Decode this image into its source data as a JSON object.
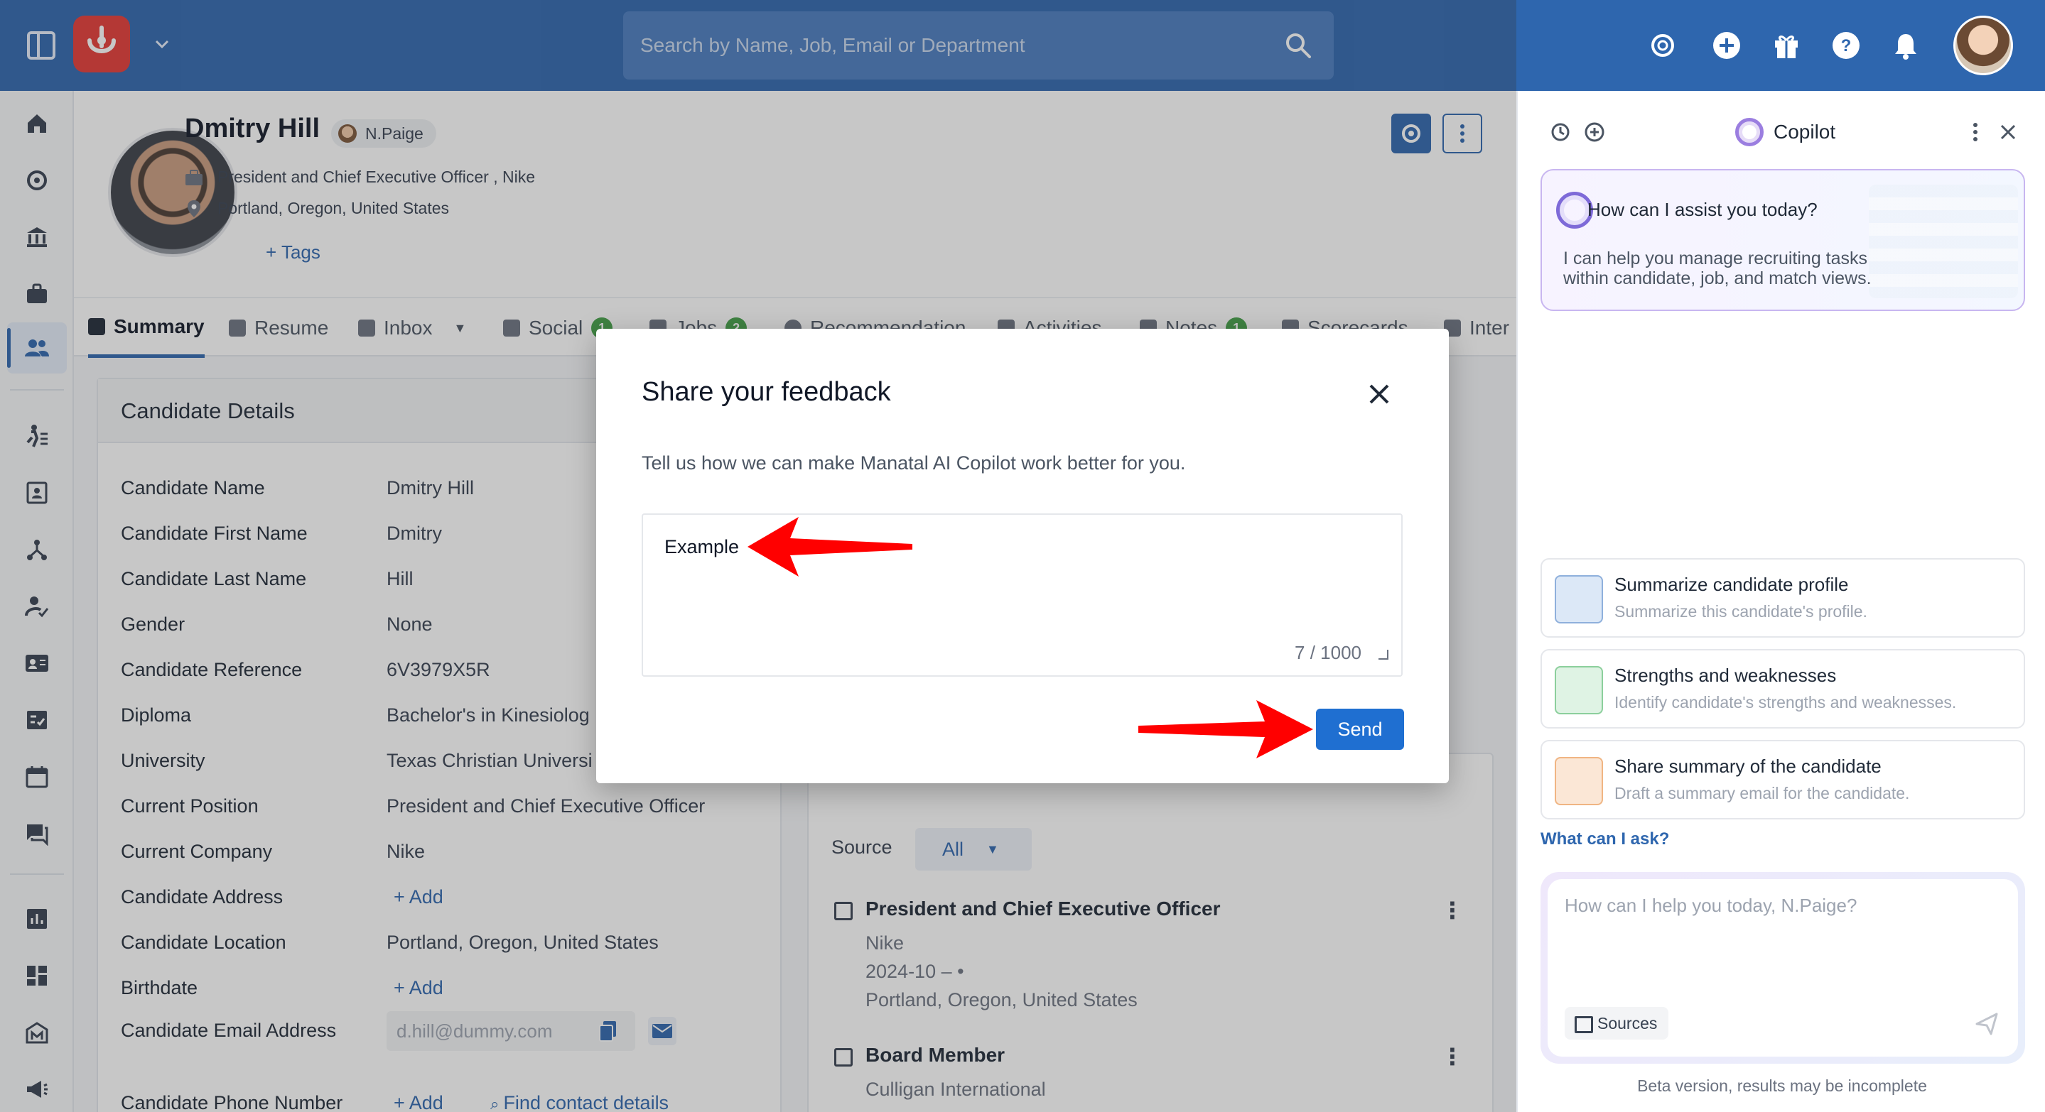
{
  "topbar": {
    "search_placeholder": "Search by Name, Job, Email or Department",
    "icons": [
      "sidebar-toggle-icon",
      "app-logo",
      "chevron-down-icon",
      "search-icon",
      "copilot-icon",
      "add-icon",
      "gift-icon",
      "help-icon",
      "bell-icon",
      "user-avatar"
    ]
  },
  "sidebar": {
    "items": [
      "home-icon",
      "copilot-icon",
      "organization-icon",
      "jobs-icon",
      "candidates-icon",
      "recruitment-icon",
      "contacts-icon",
      "network-icon",
      "tasks-icon",
      "id-card-icon",
      "checklist-icon",
      "calendar-icon",
      "messages-icon",
      "reports-icon",
      "dashboard-icon",
      "marketplace-icon",
      "announcements-icon"
    ]
  },
  "profile": {
    "name": "Dmitry Hill",
    "owner": "N.Paige",
    "position_line": "President and Chief Executive Officer , Nike",
    "location": "Portland, Oregon, United States",
    "tags_link": "+ Tags"
  },
  "tabs": [
    {
      "label": "Summary",
      "badge": ""
    },
    {
      "label": "Resume",
      "badge": ""
    },
    {
      "label": "Inbox",
      "badge": ""
    },
    {
      "label": "Social",
      "badge": "1"
    },
    {
      "label": "Jobs",
      "badge": "2"
    },
    {
      "label": "Recommendation",
      "badge": ""
    },
    {
      "label": "Activities",
      "badge": ""
    },
    {
      "label": "Notes",
      "badge": "1"
    },
    {
      "label": "Scorecards",
      "badge": ""
    },
    {
      "label": "Inter",
      "badge": ""
    }
  ],
  "details": {
    "title": "Candidate Details",
    "rows": [
      {
        "label": "Candidate Name",
        "value": "Dmitry Hill"
      },
      {
        "label": "Candidate First Name",
        "value": "Dmitry"
      },
      {
        "label": "Candidate Last Name",
        "value": "Hill"
      },
      {
        "label": "Gender",
        "value": "None"
      },
      {
        "label": "Candidate Reference",
        "value": "6V3979X5R"
      },
      {
        "label": "Diploma",
        "value": "Bachelor's in Kinesiolog"
      },
      {
        "label": "University",
        "value": "Texas Christian Universi"
      },
      {
        "label": "Current Position",
        "value": "President and Chief Executive Officer"
      },
      {
        "label": "Current Company",
        "value": "Nike"
      },
      {
        "label": "Candidate Address",
        "value": "+ Add"
      },
      {
        "label": "Candidate Location",
        "value": "Portland, Oregon, United States"
      },
      {
        "label": "Birthdate",
        "value": "+ Add"
      },
      {
        "label": "Candidate Email Address",
        "value": "d.hill@dummy.com"
      },
      {
        "label": "Candidate Phone Number",
        "value": "+ Add"
      }
    ],
    "find_contact": "Find contact details"
  },
  "work": {
    "source_label": "Source",
    "source_value": "All",
    "entries": [
      {
        "title": "President and Chief Executive Officer",
        "company": "Nike",
        "dates": "2024-10 – •",
        "location": "Portland, Oregon, United States"
      },
      {
        "title": "Board Member",
        "company": "Culligan International"
      }
    ]
  },
  "copilot": {
    "title": "Copilot",
    "hero_title": "How can I assist you today?",
    "hero_text": "I can help you manage recruiting tasks within candidate, job, and match views.",
    "cards": [
      {
        "title": "Summarize candidate profile",
        "sub": "Summarize this candidate's profile."
      },
      {
        "title": "Strengths and weaknesses",
        "sub": "Identify candidate's strengths and weaknesses."
      },
      {
        "title": "Share summary of the candidate",
        "sub": "Draft a summary email for the candidate."
      }
    ],
    "ask_link": "What can I ask?",
    "input_placeholder": "How can I help you today, N.Paige?",
    "sources": "Sources",
    "beta": "Beta version, results may be incomplete"
  },
  "modal": {
    "title": "Share your feedback",
    "description": "Tell us how we can make Manatal AI Copilot work better for you.",
    "feedback_value": "Example",
    "counter": "7 / 1000",
    "send_label": "Send"
  },
  "colors": {
    "topbar": "#2e66ae",
    "primary_button": "#1f6fd1",
    "logo": "#e53935",
    "annotation_arrow": "#ff0000"
  }
}
